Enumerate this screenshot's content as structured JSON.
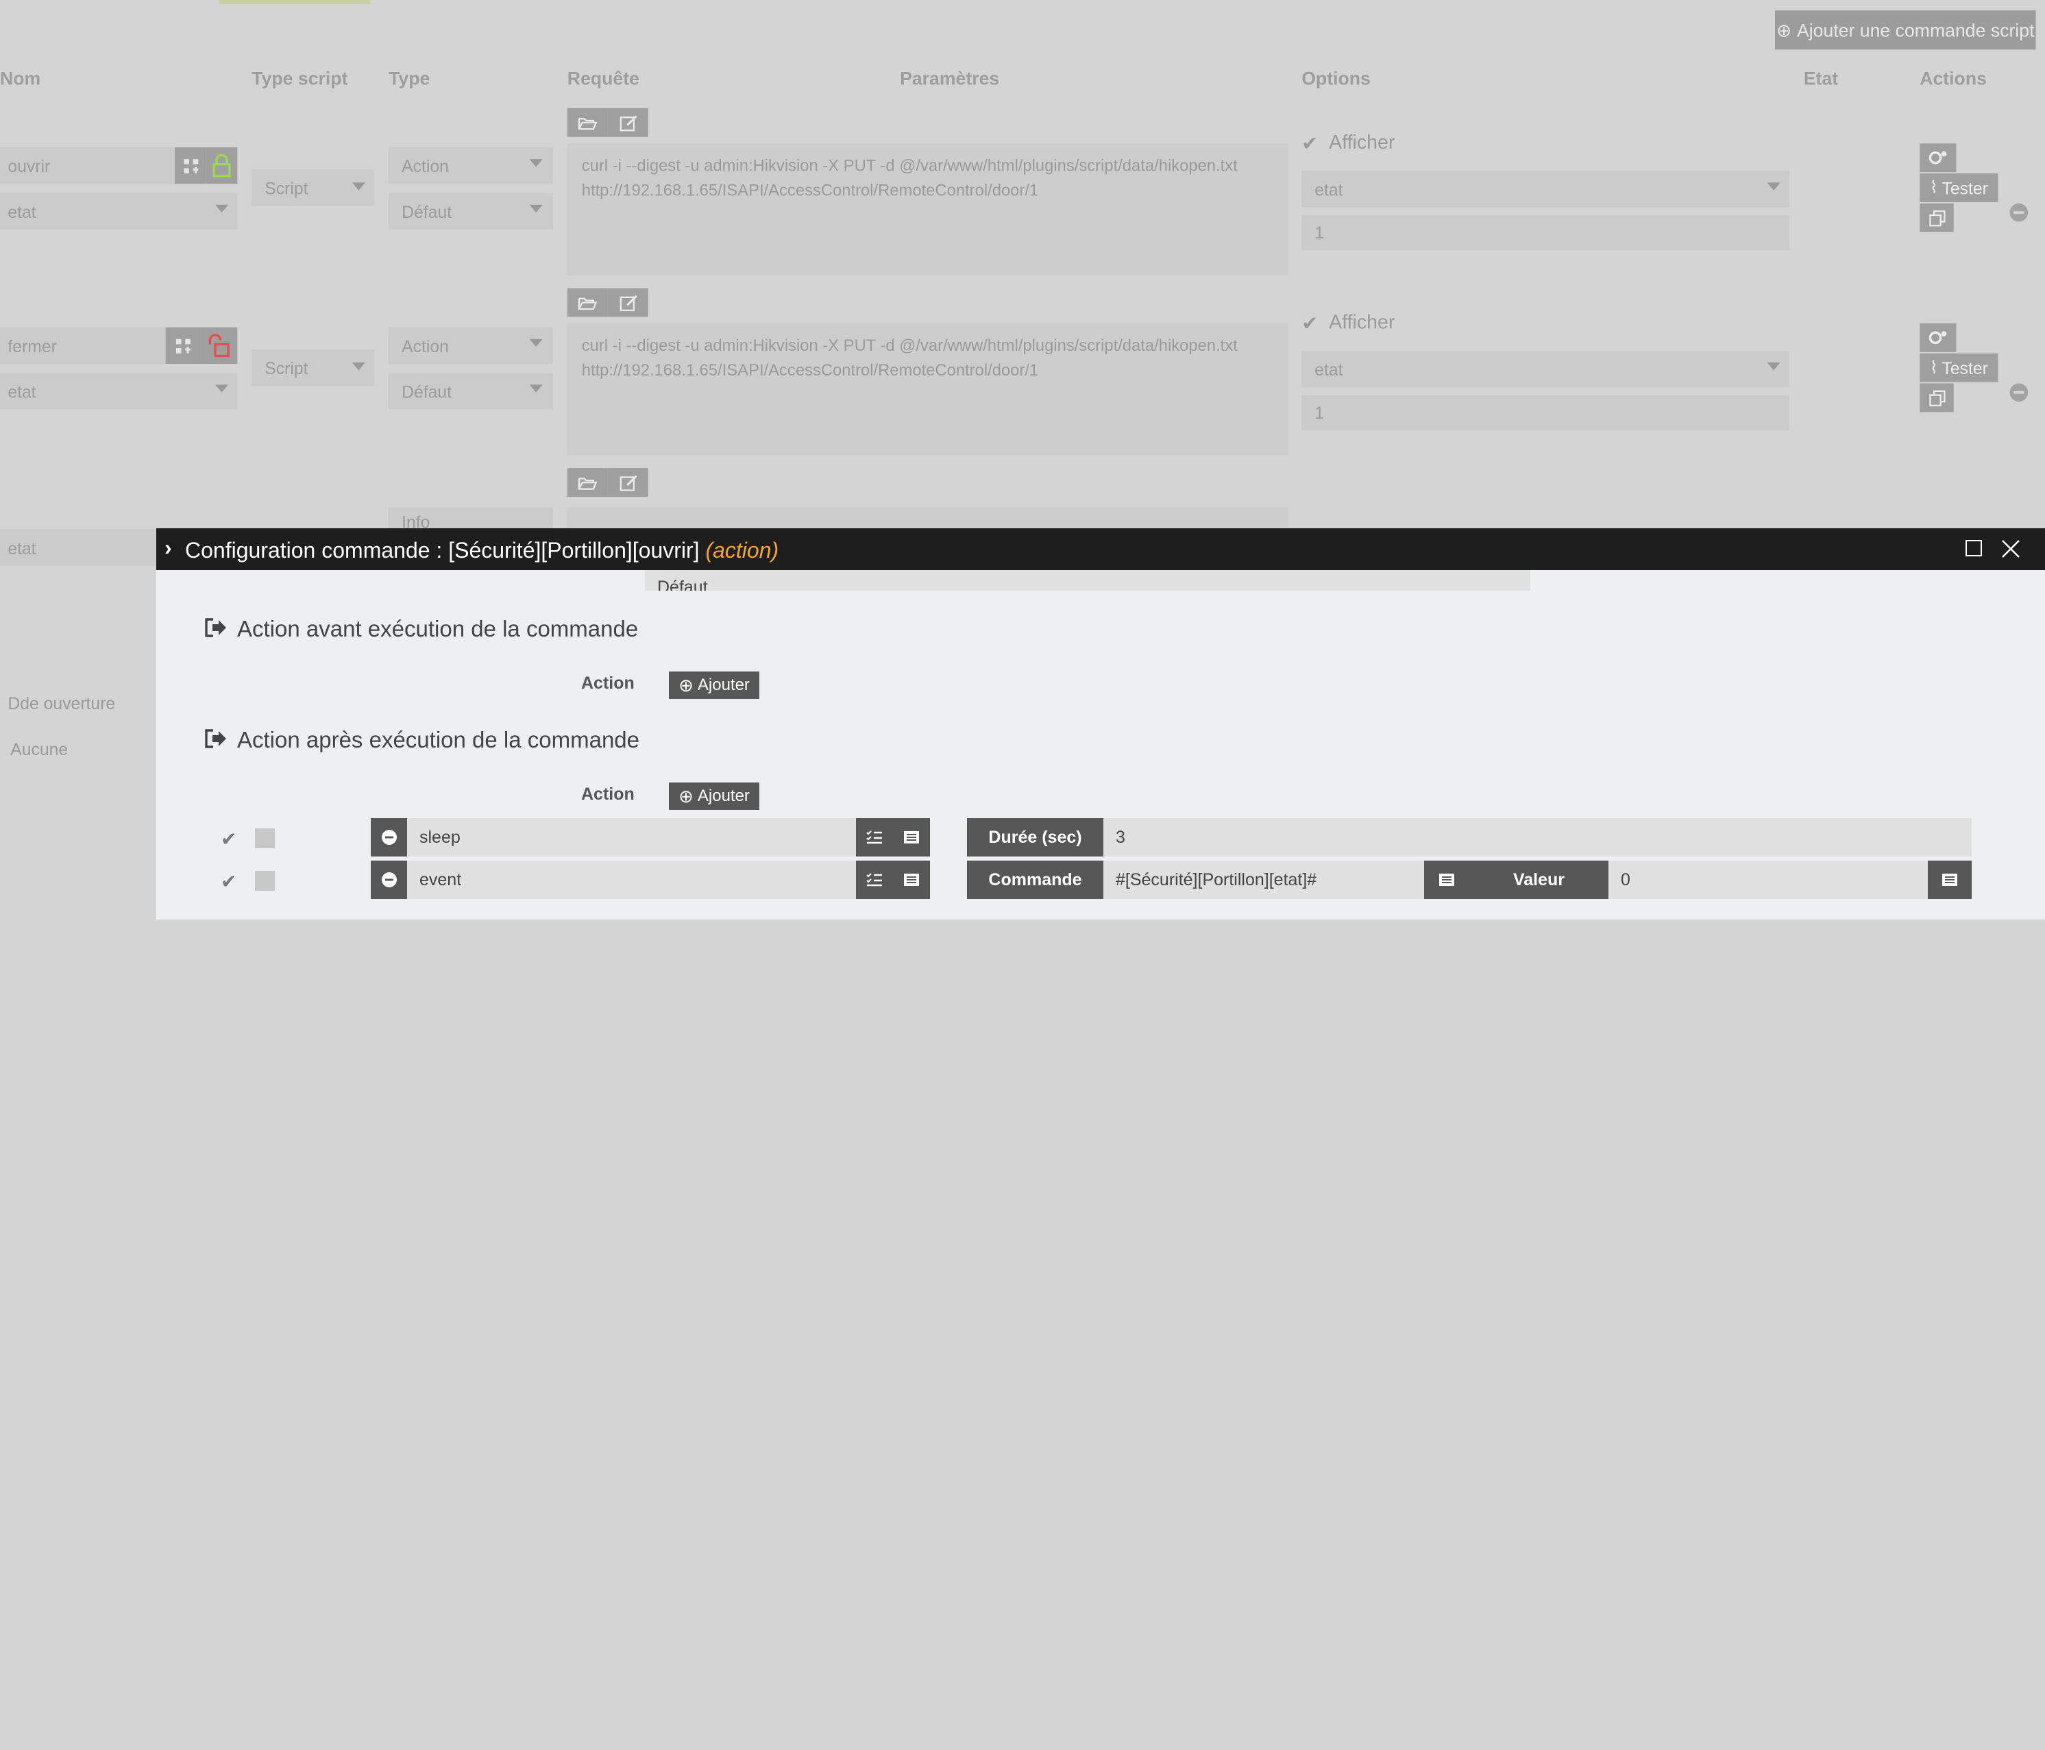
{
  "add_script_command": "Ajouter une commande script",
  "columns": {
    "nom": "Nom",
    "type_script": "Type script",
    "type": "Type",
    "requete": "Requête",
    "parametres": "Paramètres",
    "options": "Options",
    "etat": "Etat",
    "actions": "Actions"
  },
  "rows": [
    {
      "name": "ouvrir",
      "subname": "etat",
      "script_type": "Script",
      "type": "Action",
      "subtype": "Défaut",
      "request": "curl -i --digest -u admin:Hikvision -X PUT -d @/var/www/html/plugins/script/data/hikopen.txt\nhttp://192.168.1.65/ISAPI/AccessControl/RemoteControl/door/1",
      "afficher": "Afficher",
      "option_select": "etat",
      "option_value": "1",
      "tester": "Tester",
      "lock_state": "unlocked-green"
    },
    {
      "name": "fermer",
      "subname": "etat",
      "script_type": "Script",
      "type": "Action",
      "subtype": "Défaut",
      "request": "curl -i --digest -u admin:Hikvision -X PUT -d @/var/www/html/plugins/script/data/hikopen.txt\nhttp://192.168.1.65/ISAPI/AccessControl/RemoteControl/door/1",
      "afficher": "Afficher",
      "option_select": "etat",
      "option_value": "1",
      "tester": "Tester",
      "lock_state": "unlocked-red"
    }
  ],
  "row3": {
    "name": "etat",
    "type": "Info"
  },
  "row4": {
    "name": "Dde ouverture",
    "subname": "Aucune"
  },
  "modal": {
    "title_prefix": "Configuration commande : [Sécurité][Portillon][ouvrir]",
    "title_suffix": "(action)",
    "partial_field_value": "Défaut",
    "section_before": "Action avant exécution de la commande",
    "section_after": "Action après exécution de la commande",
    "action_label": "Action",
    "ajouter": "Ajouter",
    "actions": [
      {
        "cmd": "sleep",
        "param_label": "Durée (sec)",
        "param_value": "3"
      },
      {
        "cmd": "event",
        "param_label": "Commande",
        "param_value": "#[Sécurité][Portillon][etat]#",
        "extra_label": "Valeur",
        "extra_value": "0"
      }
    ]
  },
  "colors": {
    "accent_orange": "#f5a623",
    "modal_titlebar": "#1e1e1e",
    "lock_green": "#9bd84a",
    "lock_red": "#e05050"
  }
}
